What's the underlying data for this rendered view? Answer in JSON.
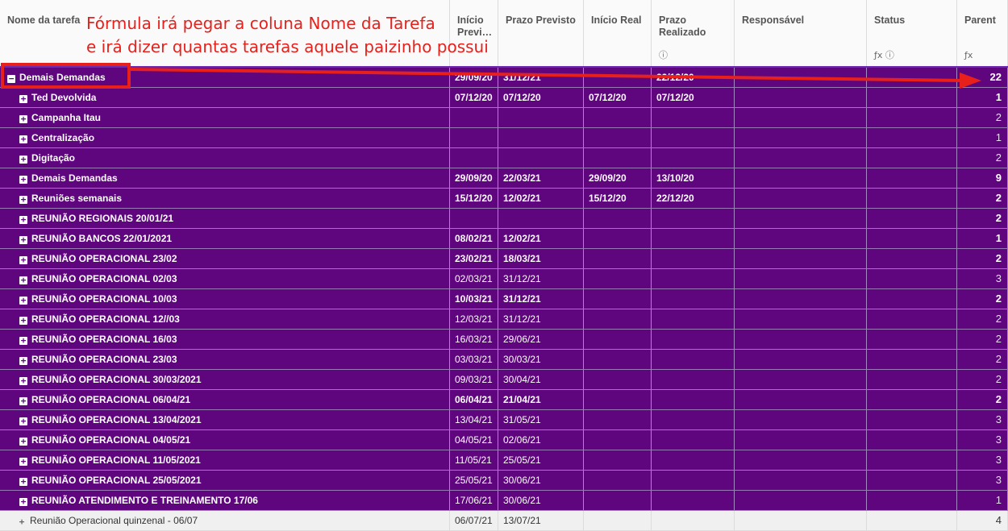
{
  "columns": [
    {
      "key": "name",
      "label": "Nome da tarefa",
      "icons": ""
    },
    {
      "key": "start_planned",
      "label": "Início\nPrevi…",
      "icons": ""
    },
    {
      "key": "due_planned",
      "label": "Prazo Previsto",
      "icons": ""
    },
    {
      "key": "start_actual",
      "label": "Início Real",
      "icons": ""
    },
    {
      "key": "due_actual",
      "label": "Prazo\nRealizado",
      "icons": "ⓘ"
    },
    {
      "key": "owner",
      "label": "Responsável",
      "icons": ""
    },
    {
      "key": "status",
      "label": "Status",
      "icons": "ƒx ⓘ"
    },
    {
      "key": "parent",
      "label": "Parent",
      "icons": "ƒx"
    }
  ],
  "annotation": {
    "line1": "Fórmula irá pegar a coluna Nome da Tarefa",
    "line2": "e irá dizer quantas tarefas aquele paizinho possui",
    "color": "#e8201b"
  },
  "colors": {
    "row_bg": "#5f067f",
    "header_underline": "#6b2ab0",
    "annotation": "#e8201b"
  },
  "rows": [
    {
      "level": 0,
      "expander": "−",
      "name": "Demais Demandas",
      "start_planned": "29/09/20",
      "due_planned": "31/12/21",
      "start_actual": "",
      "due_actual": "22/12/20",
      "owner": "",
      "status": "",
      "parent": "22",
      "bold": true
    },
    {
      "level": 1,
      "expander": "+",
      "name": "Ted Devolvida",
      "start_planned": "07/12/20",
      "due_planned": "07/12/20",
      "start_actual": "07/12/20",
      "due_actual": "07/12/20",
      "owner": "",
      "status": "",
      "parent": "1",
      "bold": true
    },
    {
      "level": 1,
      "expander": "+",
      "name": "Campanha Itau",
      "start_planned": "",
      "due_planned": "",
      "start_actual": "",
      "due_actual": "",
      "owner": "",
      "status": "",
      "parent": "2",
      "bold": false
    },
    {
      "level": 1,
      "expander": "+",
      "name": "Centralização",
      "start_planned": "",
      "due_planned": "",
      "start_actual": "",
      "due_actual": "",
      "owner": "",
      "status": "",
      "parent": "1",
      "bold": false
    },
    {
      "level": 1,
      "expander": "+",
      "name": "Digitação",
      "start_planned": "",
      "due_planned": "",
      "start_actual": "",
      "due_actual": "",
      "owner": "",
      "status": "",
      "parent": "2",
      "bold": false
    },
    {
      "level": 1,
      "expander": "+",
      "name": "Demais Demandas",
      "start_planned": "29/09/20",
      "due_planned": "22/03/21",
      "start_actual": "29/09/20",
      "due_actual": "13/10/20",
      "owner": "",
      "status": "",
      "parent": "9",
      "bold": true
    },
    {
      "level": 1,
      "expander": "+",
      "name": "Reuniões semanais",
      "start_planned": "15/12/20",
      "due_planned": "12/02/21",
      "start_actual": "15/12/20",
      "due_actual": "22/12/20",
      "owner": "",
      "status": "",
      "parent": "2",
      "bold": true
    },
    {
      "level": 1,
      "expander": "+",
      "name": "REUNIÃO REGIONAIS 20/01/21",
      "start_planned": "",
      "due_planned": "",
      "start_actual": "",
      "due_actual": "",
      "owner": "",
      "status": "",
      "parent": "2",
      "bold": true
    },
    {
      "level": 1,
      "expander": "+",
      "name": "REUNIÃO BANCOS 22/01/2021",
      "start_planned": "08/02/21",
      "due_planned": "12/02/21",
      "start_actual": "",
      "due_actual": "",
      "owner": "",
      "status": "",
      "parent": "1",
      "bold": true
    },
    {
      "level": 1,
      "expander": "+",
      "name": "REUNIÃO OPERACIONAL 23/02",
      "start_planned": "23/02/21",
      "due_planned": "18/03/21",
      "start_actual": "",
      "due_actual": "",
      "owner": "",
      "status": "",
      "parent": "2",
      "bold": true
    },
    {
      "level": 1,
      "expander": "+",
      "name": "REUNIÃO OPERACIONAL 02/03",
      "start_planned": "02/03/21",
      "due_planned": "31/12/21",
      "start_actual": "",
      "due_actual": "",
      "owner": "",
      "status": "",
      "parent": "3",
      "bold": false
    },
    {
      "level": 1,
      "expander": "+",
      "name": "REUNIÃO OPERACIONAL 10/03",
      "start_planned": "10/03/21",
      "due_planned": "31/12/21",
      "start_actual": "",
      "due_actual": "",
      "owner": "",
      "status": "",
      "parent": "2",
      "bold": true
    },
    {
      "level": 1,
      "expander": "+",
      "name": "REUNIÃO OPERACIONAL 12//03",
      "start_planned": "12/03/21",
      "due_planned": "31/12/21",
      "start_actual": "",
      "due_actual": "",
      "owner": "",
      "status": "",
      "parent": "2",
      "bold": false
    },
    {
      "level": 1,
      "expander": "+",
      "name": "REUNIÃO OPERACIONAL 16/03",
      "start_planned": "16/03/21",
      "due_planned": "29/06/21",
      "start_actual": "",
      "due_actual": "",
      "owner": "",
      "status": "",
      "parent": "2",
      "bold": false
    },
    {
      "level": 1,
      "expander": "+",
      "name": "REUNIÃO OPERACIONAL 23/03",
      "start_planned": "03/03/21",
      "due_planned": "30/03/21",
      "start_actual": "",
      "due_actual": "",
      "owner": "",
      "status": "",
      "parent": "2",
      "bold": false
    },
    {
      "level": 1,
      "expander": "+",
      "name": "REUNIÃO OPERACIONAL 30/03/2021",
      "start_planned": "09/03/21",
      "due_planned": "30/04/21",
      "start_actual": "",
      "due_actual": "",
      "owner": "",
      "status": "",
      "parent": "2",
      "bold": false
    },
    {
      "level": 1,
      "expander": "+",
      "name": "REUNIÃO OPERACIONAL 06/04/21",
      "start_planned": "06/04/21",
      "due_planned": "21/04/21",
      "start_actual": "",
      "due_actual": "",
      "owner": "",
      "status": "",
      "parent": "2",
      "bold": true
    },
    {
      "level": 1,
      "expander": "+",
      "name": "REUNIÃO OPERACIONAL 13/04/2021",
      "start_planned": "13/04/21",
      "due_planned": "31/05/21",
      "start_actual": "",
      "due_actual": "",
      "owner": "",
      "status": "",
      "parent": "3",
      "bold": false
    },
    {
      "level": 1,
      "expander": "+",
      "name": "REUNIÃO OPERACIONAL 04/05/21",
      "start_planned": "04/05/21",
      "due_planned": "02/06/21",
      "start_actual": "",
      "due_actual": "",
      "owner": "",
      "status": "",
      "parent": "3",
      "bold": false
    },
    {
      "level": 1,
      "expander": "+",
      "name": "REUNIÃO OPERACIONAL 11/05/2021",
      "start_planned": "11/05/21",
      "due_planned": "25/05/21",
      "start_actual": "",
      "due_actual": "",
      "owner": "",
      "status": "",
      "parent": "3",
      "bold": false
    },
    {
      "level": 1,
      "expander": "+",
      "name": "REUNIÃO OPERACIONAL 25/05/2021",
      "start_planned": "25/05/21",
      "due_planned": "30/06/21",
      "start_actual": "",
      "due_actual": "",
      "owner": "",
      "status": "",
      "parent": "3",
      "bold": false
    },
    {
      "level": 1,
      "expander": "+",
      "name": "REUNIÃO ATENDIMENTO E TREINAMENTO 17/06",
      "start_planned": "17/06/21",
      "due_planned": "30/06/21",
      "start_actual": "",
      "due_actual": "",
      "owner": "",
      "status": "",
      "parent": "1",
      "bold": false
    },
    {
      "level": 2,
      "expander": "+",
      "name": "Reunião Operacional quinzenal - 06/07",
      "start_planned": "06/07/21",
      "due_planned": "13/07/21",
      "start_actual": "",
      "due_actual": "",
      "owner": "",
      "status": "",
      "parent": "4",
      "bold": false,
      "gray": true
    }
  ]
}
